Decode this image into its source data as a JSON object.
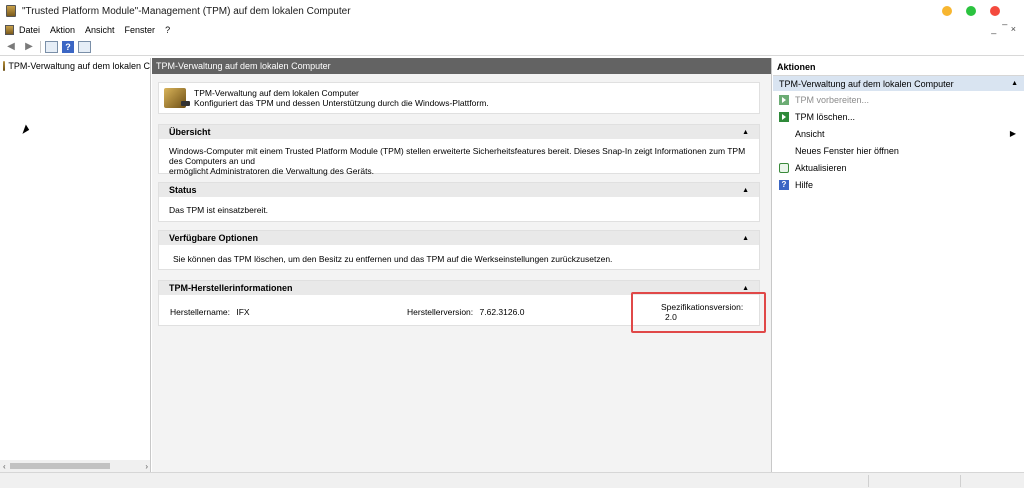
{
  "window": {
    "title": "\"Trusted Platform Module\"-Management (TPM) auf dem lokalen Computer",
    "app_icon": "tpm-chip-icon"
  },
  "menubar": {
    "items": [
      "Datei",
      "Aktion",
      "Ansicht",
      "Fenster",
      "?"
    ],
    "controls": [
      "_",
      " ̅",
      "×"
    ]
  },
  "toolbar": {
    "back_icon": "back-arrow-icon",
    "forward_icon": "forward-arrow-icon",
    "help_label": "?"
  },
  "tree": {
    "items": [
      {
        "label": "TPM-Verwaltung auf dem lokalen C",
        "icon": "tpm-chip-icon"
      }
    ]
  },
  "main": {
    "header": "TPM-Verwaltung auf dem lokalen Computer",
    "intro": {
      "line1": "TPM-Verwaltung auf dem lokalen Computer",
      "line2": "Konfiguriert das TPM und dessen Unterstützung durch die Windows-Plattform."
    },
    "sections": {
      "overview": {
        "title": "Übersicht",
        "line1": "Windows-Computer mit einem Trusted Platform Module (TPM) stellen erweiterte Sicherheitsfeatures bereit. Dieses Snap-In zeigt Informationen zum TPM des Computers an und",
        "line2": "ermöglicht Administratoren die Verwaltung des Geräts."
      },
      "status": {
        "title": "Status",
        "text": "Das TPM ist einsatzbereit."
      },
      "options": {
        "title": "Verfügbare Optionen",
        "text": "Sie können das TPM löschen, um den Besitz zu entfernen und das TPM auf die Werkseinstellungen zurückzusetzen."
      },
      "vendor": {
        "title": "TPM-Herstellerinformationen",
        "name_label": "Herstellername:",
        "name_value": "IFX",
        "version_label": "Herstellerversion:",
        "version_value": "7.62.3126.0",
        "spec_label": "Spezifikationsversion:",
        "spec_value": "2.0"
      }
    }
  },
  "actions": {
    "header": "Aktionen",
    "sub": "TPM-Verwaltung auf dem lokalen Computer",
    "items": [
      {
        "label": "TPM vorbereiten...",
        "icon": "prepare-icon",
        "disabled": true
      },
      {
        "label": "TPM löschen...",
        "icon": "clear-icon",
        "disabled": false
      },
      {
        "label": "Ansicht",
        "icon": "",
        "submenu": true
      },
      {
        "label": "Neues Fenster hier öffnen",
        "icon": ""
      },
      {
        "label": "Aktualisieren",
        "icon": "refresh-icon"
      },
      {
        "label": "Hilfe",
        "icon": "help-icon"
      }
    ]
  }
}
